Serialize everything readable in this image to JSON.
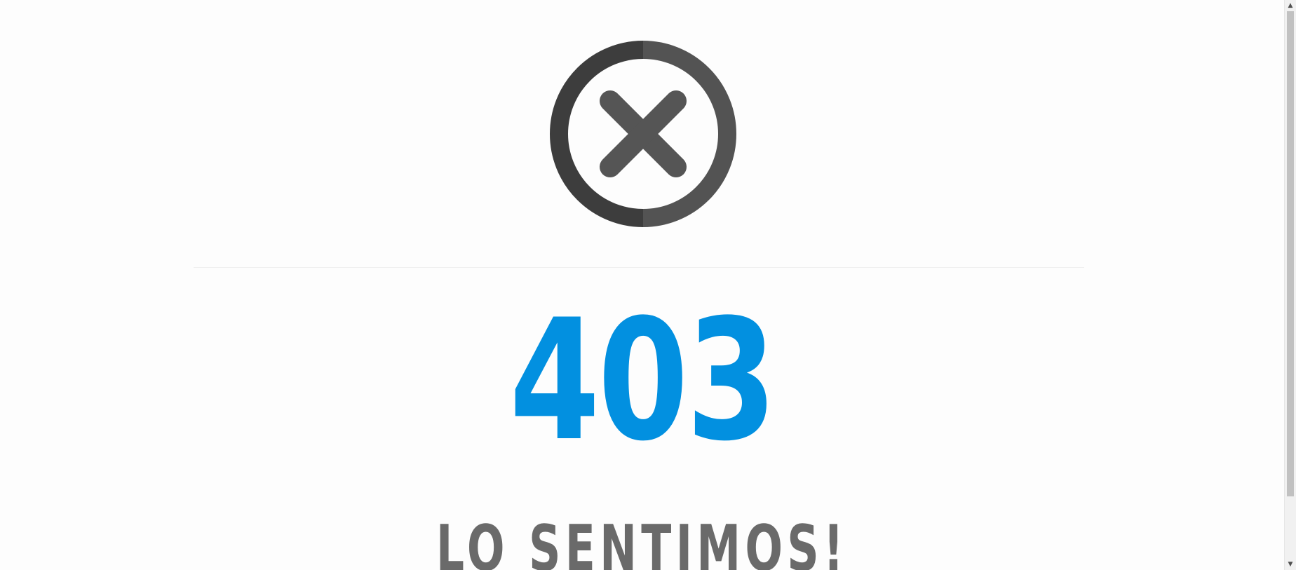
{
  "error": {
    "icon": "circle-x-icon",
    "code": "403",
    "message": "LO SENTIMOS!"
  },
  "colors": {
    "accent": "#0290e0",
    "icon": "#4a4a4a",
    "message": "#6a6a6a",
    "background": "#fdfdfd"
  },
  "scrollbar": {
    "up_arrow": "▲",
    "down_arrow": "▼"
  }
}
